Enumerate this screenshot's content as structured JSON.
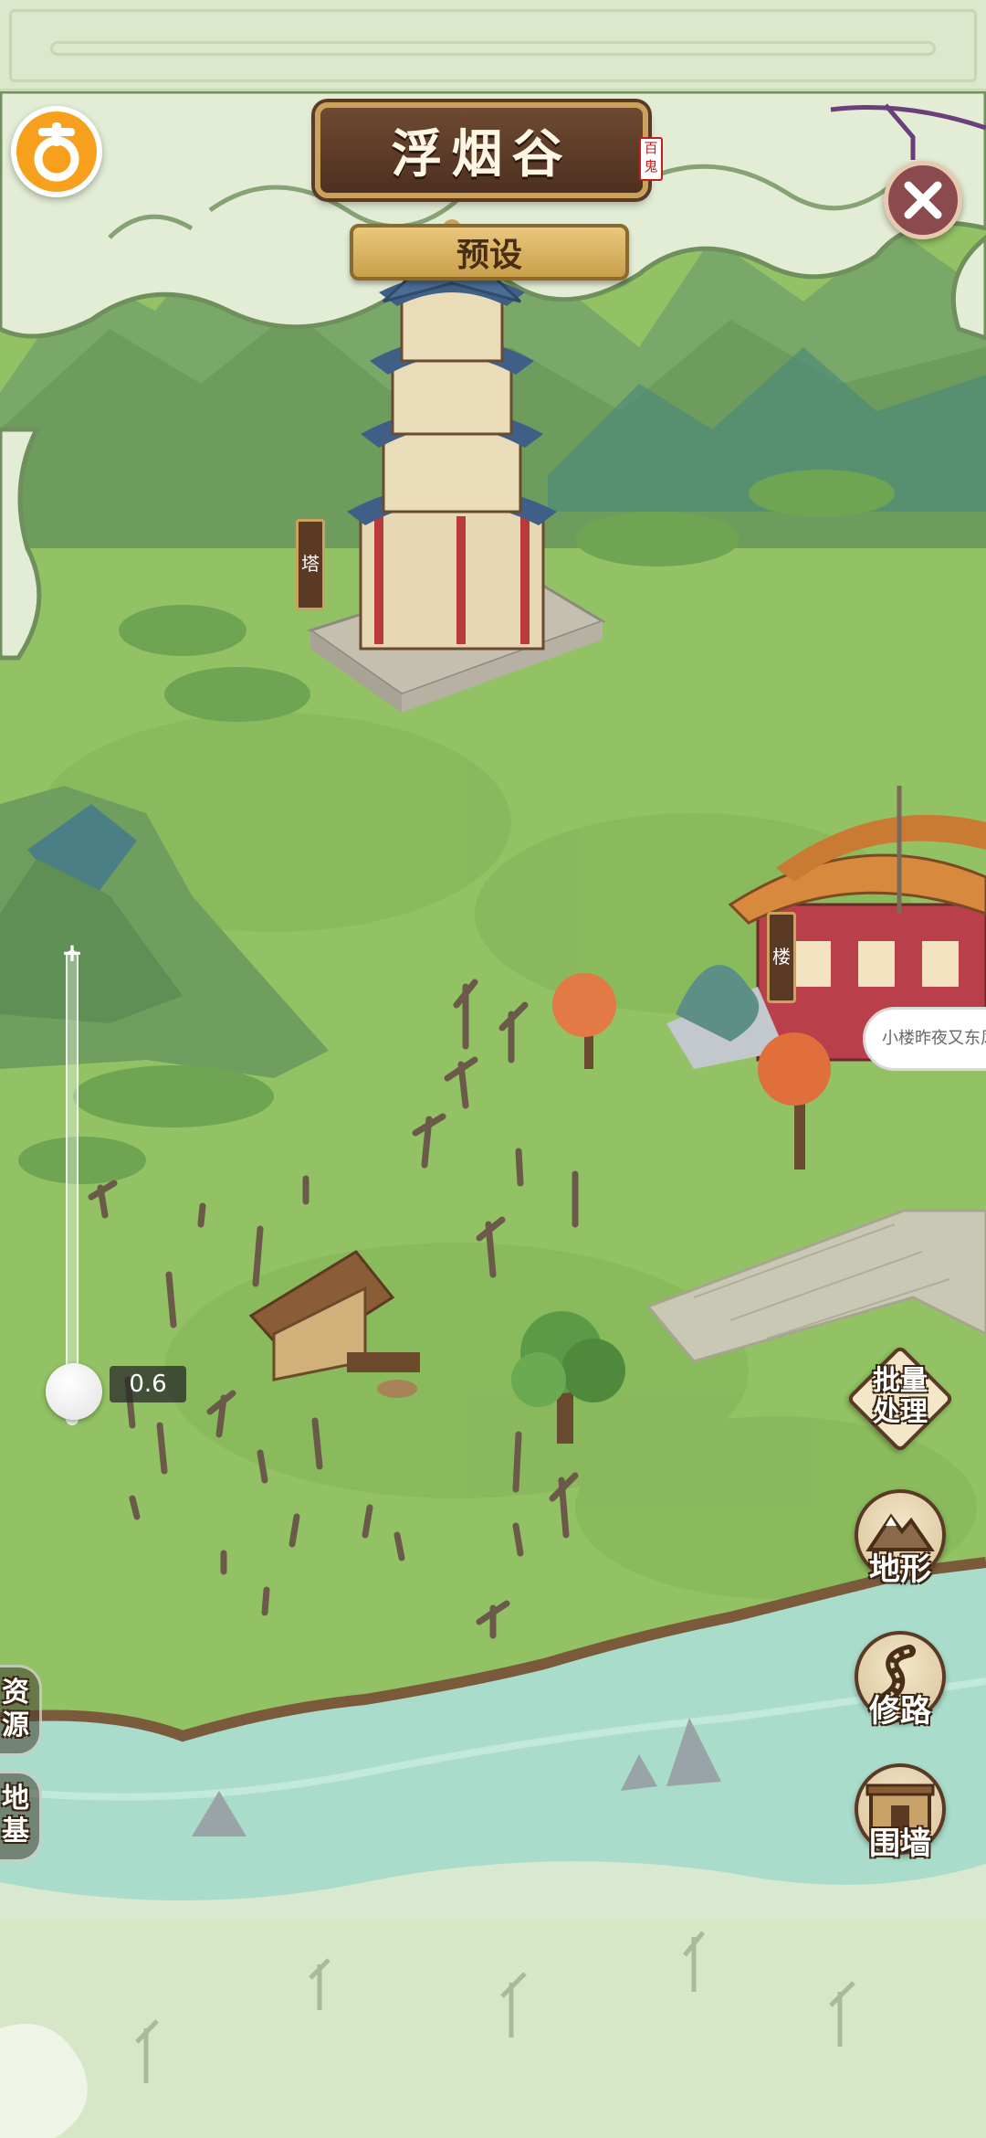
{
  "header": {
    "location_title": "浮烟谷",
    "seal_text": "百鬼",
    "preset_label": "预设",
    "logo_icon": "gourd-logo-icon",
    "close_icon": "close-icon"
  },
  "map": {
    "building_tags": [
      {
        "label": "塔"
      },
      {
        "label": "楼"
      }
    ],
    "speech_bubble": "小楼昨夜又东风"
  },
  "zoom": {
    "value_text": "0.6",
    "value": 0.6,
    "plus": "+",
    "minus": "−"
  },
  "tools": {
    "batch": {
      "line1": "批量",
      "line2": "处理"
    },
    "terrain": {
      "label": "地形",
      "icon": "mountain-icon"
    },
    "road": {
      "label": "修路",
      "icon": "road-icon"
    },
    "wall": {
      "label": "围墙",
      "icon": "wall-gate-icon"
    }
  },
  "side_tabs": {
    "resources": {
      "line1": "资",
      "line2": "源"
    },
    "foundation": {
      "line1": "地",
      "line2": "基"
    }
  },
  "colors": {
    "grass": "#8fbf62",
    "river": "#a9dccb",
    "mist": "#dbe8cc",
    "wood_dark": "#5a3a25",
    "gold": "#caa25c",
    "logo_orange": "#f7a01d"
  }
}
